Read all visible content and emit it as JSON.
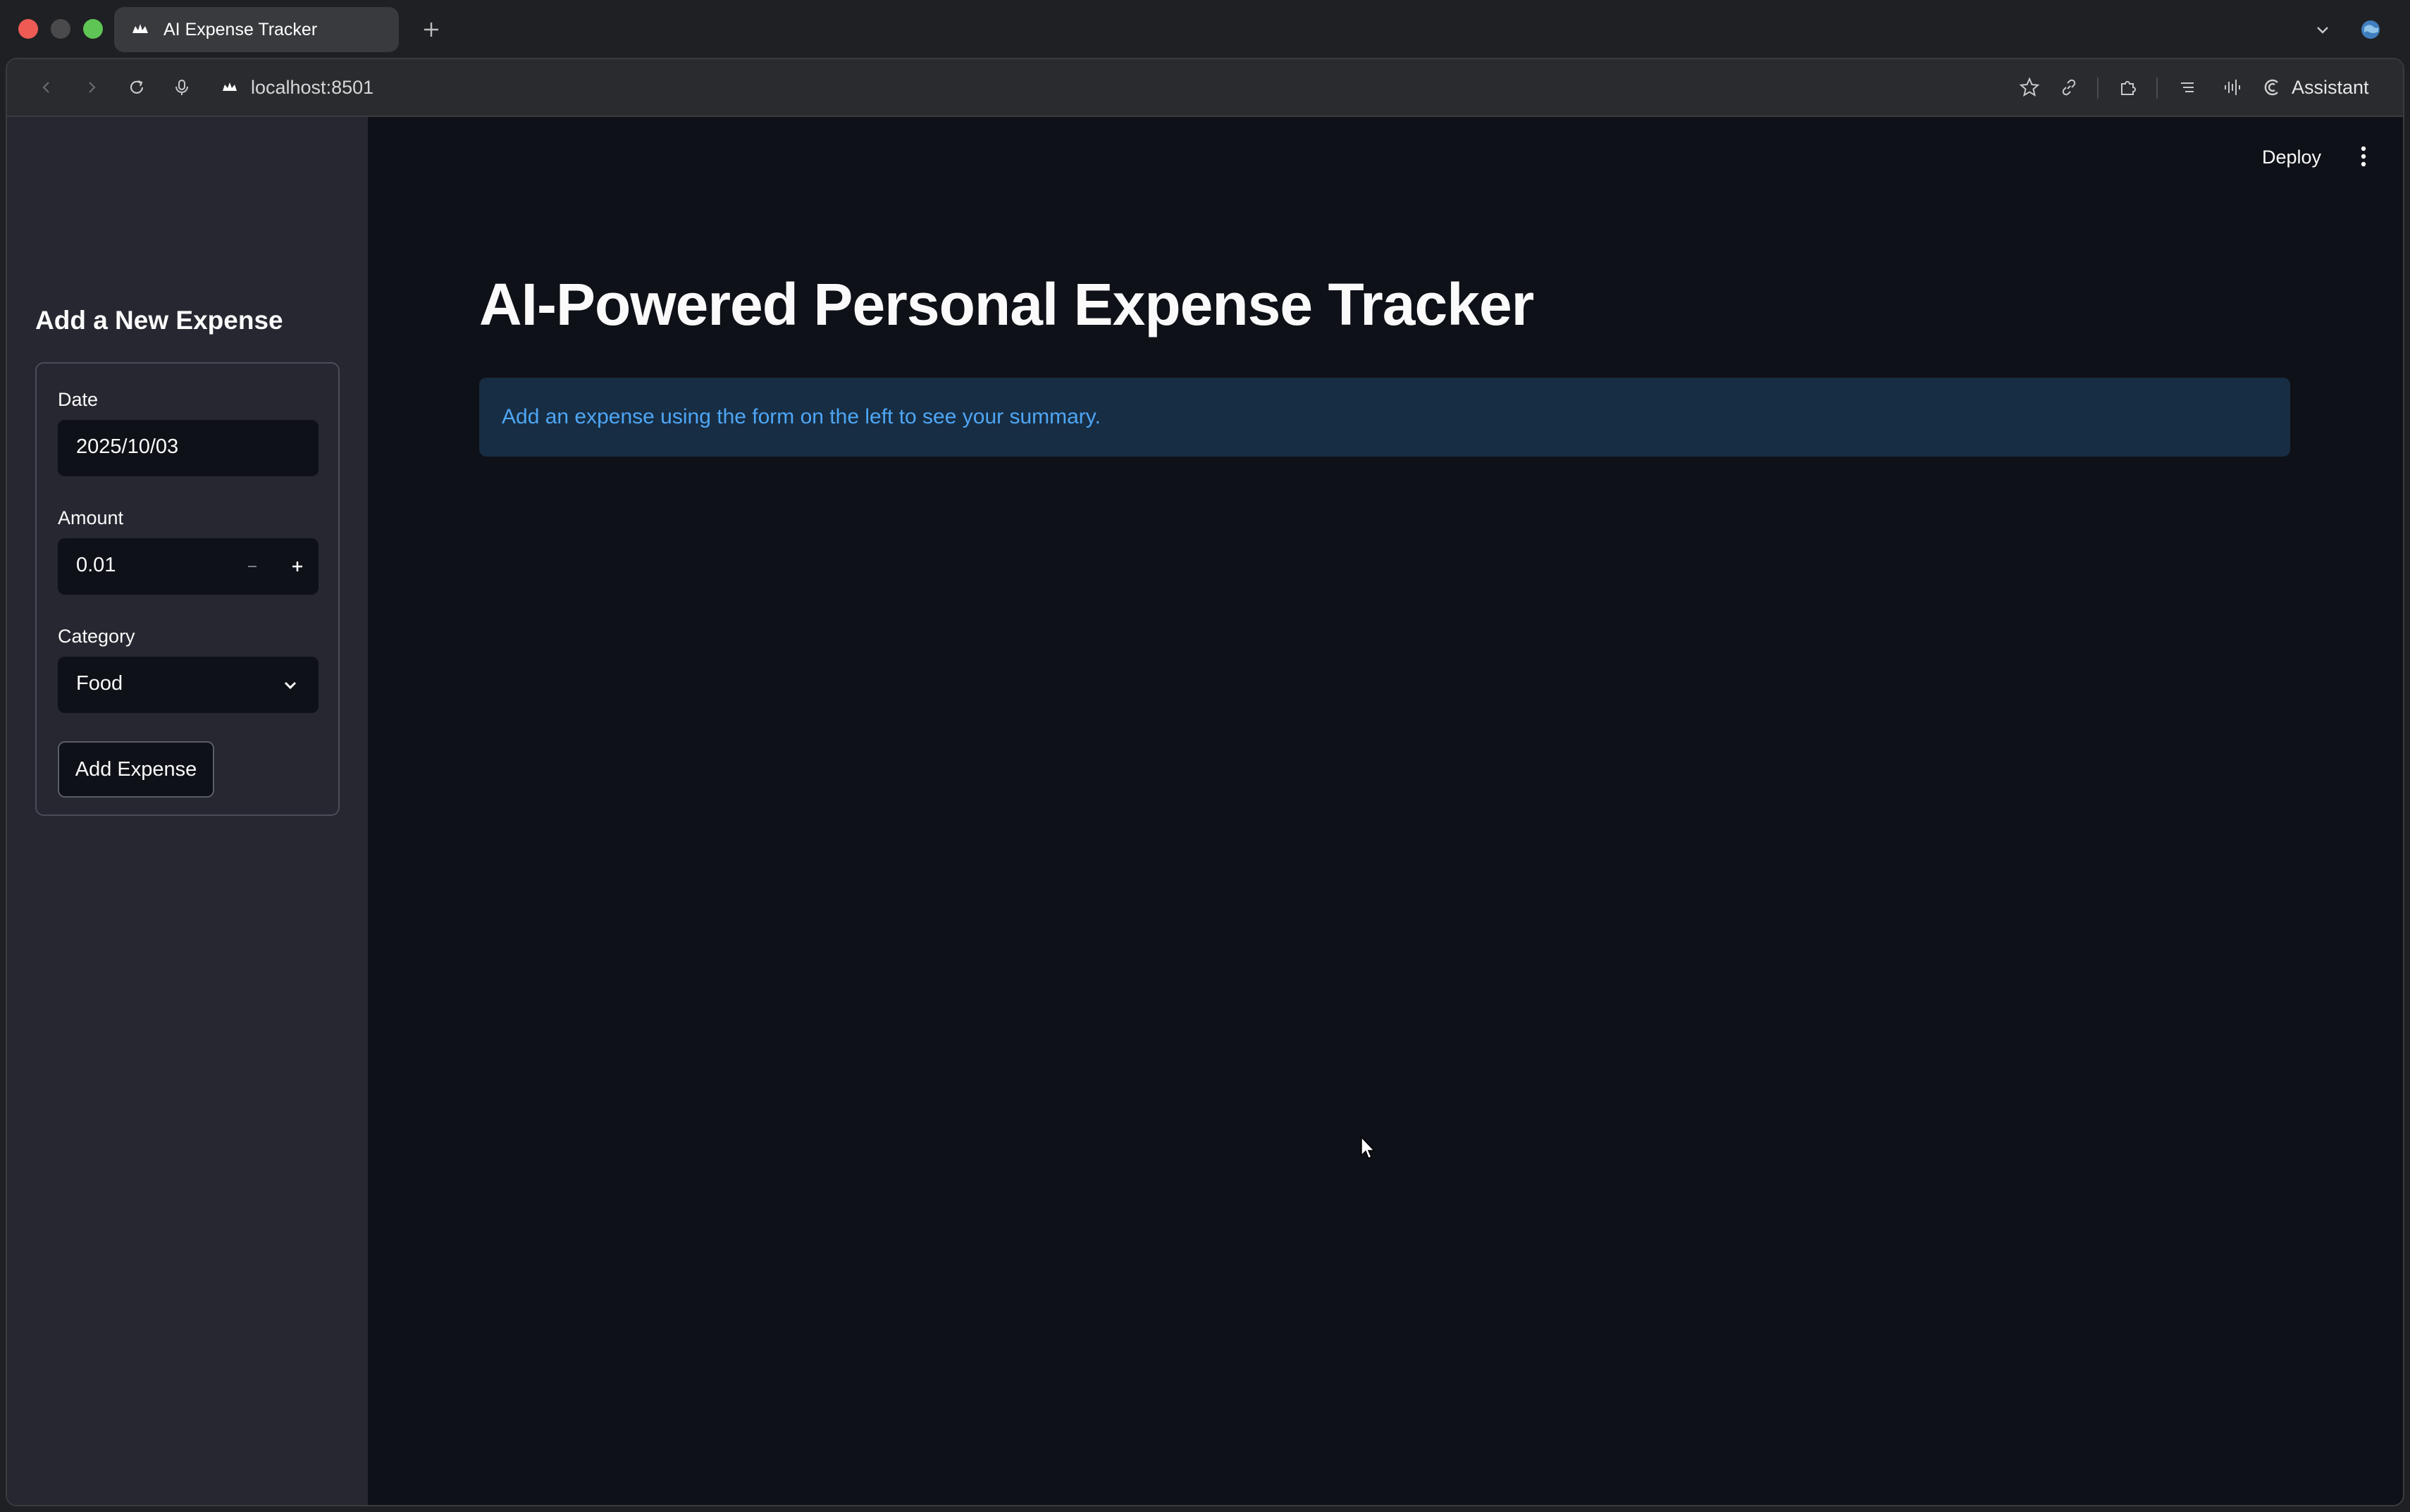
{
  "browser": {
    "tab_title": "AI Expense Tracker",
    "url": "localhost:8501",
    "assistant_label": "Assistant"
  },
  "app": {
    "deploy_label": "Deploy",
    "title": "AI-Powered Personal Expense Tracker",
    "info_message": "Add an expense using the form on the left to see your summary."
  },
  "sidebar": {
    "heading": "Add a New Expense",
    "form": {
      "date_label": "Date",
      "date_value": "2025/10/03",
      "amount_label": "Amount",
      "amount_value": "0.01",
      "category_label": "Category",
      "category_value": "Food",
      "submit_label": "Add Expense"
    }
  },
  "colors": {
    "main_bg": "#0e1117",
    "sidebar_bg": "#262730",
    "info_bg": "#172d43",
    "info_text": "#4ea6f5"
  }
}
